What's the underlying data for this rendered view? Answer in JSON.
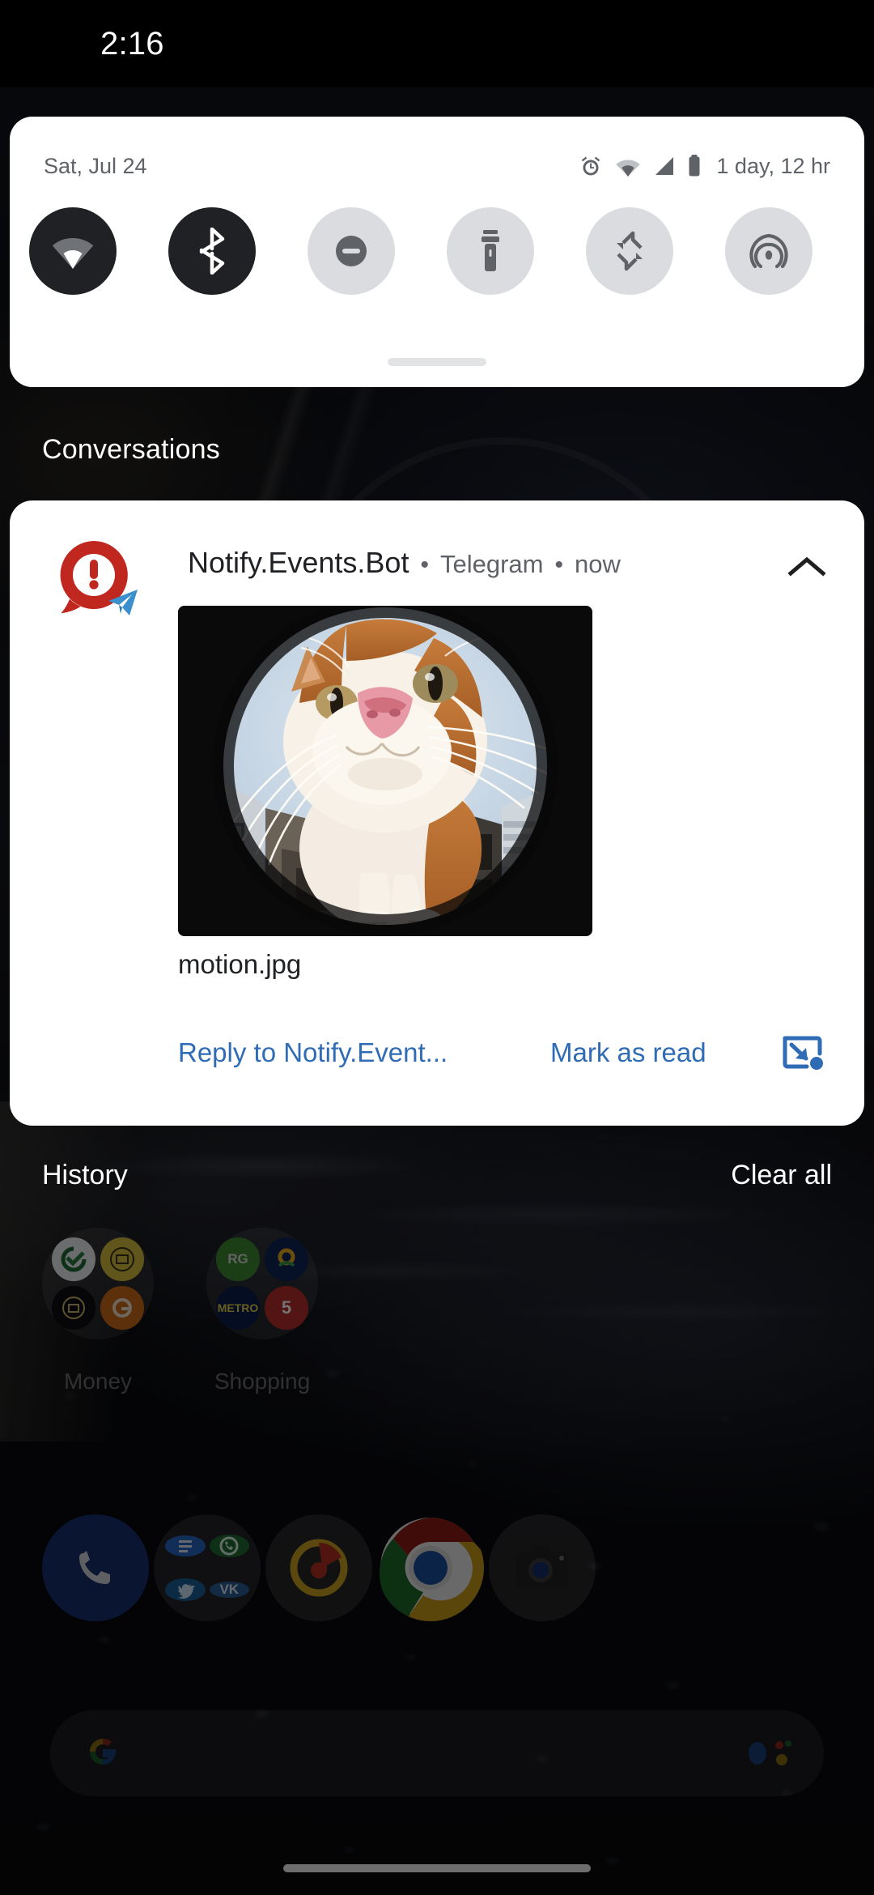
{
  "statusbar": {
    "time": "2:16"
  },
  "quick_settings": {
    "date": "Sat, Jul 24",
    "battery_estimate": "1 day, 12 hr",
    "status_icons": [
      "alarm-icon",
      "wifi-icon",
      "cellular-signal-icon",
      "battery-icon"
    ],
    "tiles": [
      {
        "name": "wifi",
        "icon": "wifi-icon",
        "state": "on"
      },
      {
        "name": "bluetooth",
        "icon": "bluetooth-icon",
        "state": "on"
      },
      {
        "name": "do-not-disturb",
        "icon": "dnd-minus-circle-icon",
        "state": "off"
      },
      {
        "name": "flashlight",
        "icon": "flashlight-icon",
        "state": "off"
      },
      {
        "name": "auto-rotate",
        "icon": "auto-rotate-icon",
        "state": "off"
      },
      {
        "name": "hotspot",
        "icon": "hotspot-broadcast-icon",
        "state": "off"
      }
    ]
  },
  "shade": {
    "conversations_label": "Conversations",
    "history_label": "History",
    "clear_all_label": "Clear all"
  },
  "notification": {
    "app_name": "Notify.Events.Bot",
    "channel": "Telegram",
    "time": "now",
    "separator": "•",
    "avatar_icon": "notify-events-exclamation-icon",
    "badge_icon": "telegram-paper-plane-icon",
    "collapse_icon": "chevron-up-icon",
    "attachment_filename": "motion.jpg",
    "attachment_alt": "fisheye photo of an orange and white cat looking into the lens",
    "actions": [
      {
        "name": "reply",
        "label": "Reply to Notify.Event..."
      },
      {
        "name": "mark-as-read",
        "label": "Mark as read"
      },
      {
        "name": "bubble",
        "label": "",
        "icon": "bubble-popout-icon"
      }
    ]
  },
  "home_screen": {
    "folders": [
      {
        "name": "money",
        "label": "Money"
      },
      {
        "name": "shopping",
        "label": "Shopping"
      }
    ],
    "shopping_tiles": [
      "RG",
      "",
      "METRO",
      "5"
    ],
    "dock": [
      {
        "name": "phone",
        "icon": "phone-icon"
      },
      {
        "name": "social-folder",
        "icon": "folder-icon"
      },
      {
        "name": "music",
        "icon": "music-note-icon"
      },
      {
        "name": "chrome",
        "icon": "chrome-icon"
      },
      {
        "name": "camera",
        "icon": "camera-icon"
      }
    ],
    "search": {
      "icon": "google-g-icon",
      "assistant_icon": "google-assistant-icon"
    }
  },
  "colors": {
    "accent_blue": "#2f6cb5",
    "tile_on": "#202124",
    "tile_off": "#dadce0",
    "notify_red": "#c0281f",
    "telegram_blue": "#2f8fd0",
    "card_white": "#ffffff"
  }
}
